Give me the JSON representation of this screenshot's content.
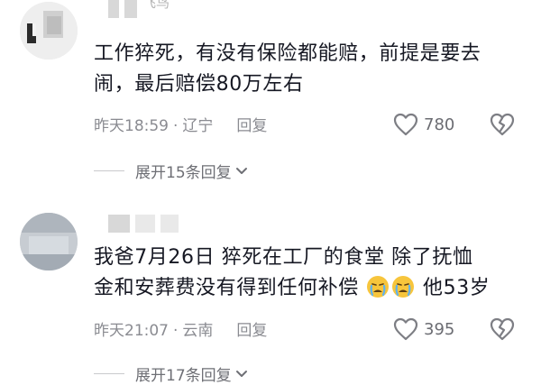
{
  "comments": [
    {
      "username_partial": "飞鸟",
      "text_line1": "工作猝死，有没有保险都能赔，前提是要去",
      "text_line2": "闹，最后赔偿80万左右",
      "time": "昨天18:59",
      "dot": "·",
      "location": "辽宁",
      "reply_label": "回复",
      "like_count": "780",
      "expand_label": "展开15条回复"
    },
    {
      "text_line1": "我爸7月26日 猝死在工厂的食堂 除了抚恤",
      "text_line2_a": "金和安葬费没有得到任何补偿",
      "text_line2_b": " 他53岁",
      "emoji_name": "crying-face",
      "time": "昨天21:07",
      "dot": "·",
      "location": "云南",
      "reply_label": "回复",
      "like_count": "395",
      "expand_label": "展开17条回复"
    }
  ],
  "colors": {
    "text": "#161823",
    "meta": "#8a8b91",
    "icon": "#7d7e84",
    "emoji": "#f7c53c"
  }
}
